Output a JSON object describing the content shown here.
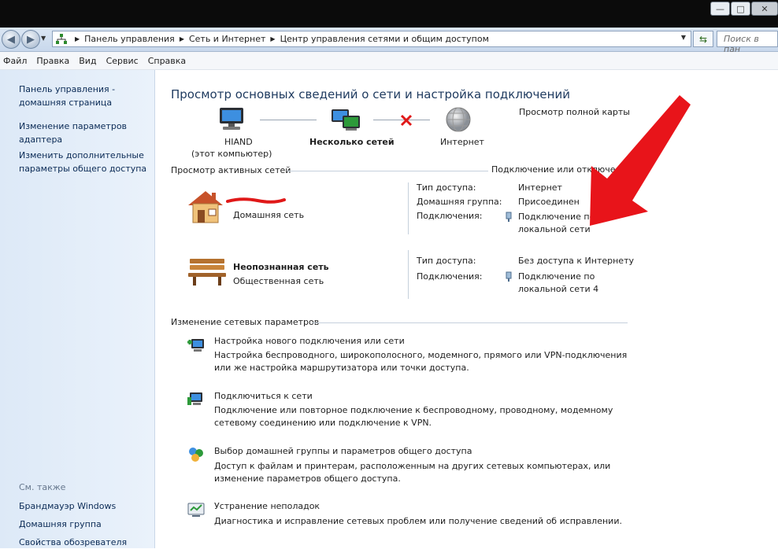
{
  "window": {
    "min_glyph": "—",
    "max_glyph": "□",
    "close_glyph": "✕"
  },
  "address": {
    "crumbs": [
      "Панель управления",
      "Сеть и Интернет",
      "Центр управления сетями и общим доступом"
    ],
    "search_placeholder": "Поиск в пан"
  },
  "menu": [
    "Файл",
    "Правка",
    "Вид",
    "Сервис",
    "Справка"
  ],
  "sidebar": {
    "links": [
      [
        "Панель управления -",
        "домашняя страница"
      ],
      [
        "Изменение параметров",
        "адаптера"
      ],
      [
        "Изменить дополнительные",
        "параметры общего доступа"
      ]
    ],
    "see_also_title": "См. также",
    "see_also": [
      "Брандмауэр Windows",
      "Домашняя группа",
      "Свойства обозревателя"
    ]
  },
  "main": {
    "title": "Просмотр основных сведений о сети и настройка подключений",
    "full_map_link": "Просмотр полной карты",
    "map": {
      "computer_name": "HIAND",
      "computer_sub": "(этот компьютер)",
      "middle": "Несколько сетей",
      "internet": "Интернет"
    },
    "active_header": "Просмотр активных сетей",
    "connect_link": "Подключение или отключе",
    "networks": [
      {
        "name": "",
        "link": "Домашняя сеть",
        "access_label": "Тип доступа:",
        "access_value": "Интернет",
        "homegroup_label": "Домашняя группа:",
        "homegroup_value": "Присоединен",
        "conn_label": "Подключения:",
        "conn_value": [
          "Подключение по",
          "локальной сети"
        ]
      },
      {
        "name": "Неопознанная сеть",
        "link": "Общественная сеть",
        "access_label": "Тип доступа:",
        "access_value": "Без доступа к Интернету",
        "conn_label": "Подключения:",
        "conn_value": [
          "Подключение по",
          "локальной сети 4"
        ]
      }
    ],
    "change_header": "Изменение сетевых параметров",
    "tasks": [
      {
        "title": "Настройка нового подключения или сети",
        "desc": [
          "Настройка беспроводного, широкополосного, модемного, прямого или VPN-подключения",
          "или же настройка маршрутизатора или точки доступа."
        ]
      },
      {
        "title": "Подключиться к сети",
        "desc": [
          "Подключение или повторное подключение к беспроводному, проводному, модемному",
          "сетевому соединению или подключение к VPN."
        ]
      },
      {
        "title": "Выбор домашней группы и параметров общего доступа",
        "desc": [
          "Доступ к файлам и принтерам, расположенным на других сетевых компьютерах, или",
          "изменение параметров общего доступа."
        ]
      },
      {
        "title": "Устранение неполадок",
        "desc": [
          "Диагностика и исправление сетевых проблем или получение сведений об исправлении."
        ]
      }
    ]
  },
  "colors": {
    "link": "#0f4d93",
    "annotation_arrow": "#e8141a"
  }
}
